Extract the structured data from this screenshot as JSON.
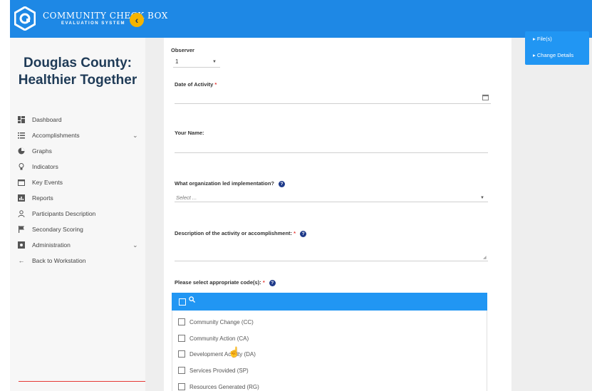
{
  "header": {
    "brand_line1": "COMMUNITY CHECK BOX",
    "brand_line2": "EVALUATION SYSTEM",
    "collapse_icon": "chevron-left-icon",
    "accent_color": "#1e88e5",
    "collapse_color": "#f5b400"
  },
  "sidebar": {
    "org_title_line1": "Douglas County:",
    "org_title_line2": "Healthier Together",
    "items": [
      {
        "label": "Dashboard",
        "icon": "dashboard-icon",
        "has_chevron": false
      },
      {
        "label": "Accomplishments",
        "icon": "list-icon",
        "has_chevron": true
      },
      {
        "label": "Graphs",
        "icon": "pie-chart-icon",
        "has_chevron": false
      },
      {
        "label": "Indicators",
        "icon": "lightbulb-icon",
        "has_chevron": false
      },
      {
        "label": "Key Events",
        "icon": "calendar-icon",
        "has_chevron": false
      },
      {
        "label": "Reports",
        "icon": "report-icon",
        "has_chevron": false
      },
      {
        "label": "Participants Description",
        "icon": "person-icon",
        "has_chevron": false
      },
      {
        "label": "Secondary Scoring",
        "icon": "flag-icon",
        "has_chevron": false
      },
      {
        "label": "Administration",
        "icon": "admin-icon",
        "has_chevron": true
      },
      {
        "label": "Back to Workstation",
        "icon": "arrow-left-icon",
        "has_chevron": false
      }
    ]
  },
  "popup": {
    "items": [
      {
        "label": "File(s)"
      },
      {
        "label": "Change Details"
      }
    ]
  },
  "form": {
    "observer_label": "Observer",
    "observer_value": "1",
    "date_label": "Date of Activity",
    "name_label": "Your Name:",
    "org_label": "What organization led implementation?",
    "org_placeholder": "Select ...",
    "description_label": "Description of the activity or accomplishment:",
    "codes_label": "Please select appropriate code(s):",
    "required_mark": "*",
    "help_glyph": "?",
    "codes": [
      {
        "label": "Community Change (CC)"
      },
      {
        "label": "Community Action (CA)"
      },
      {
        "label": "Development Activity (DA)"
      },
      {
        "label": "Services Provided (SP)"
      },
      {
        "label": "Resources Generated (RG)"
      }
    ]
  }
}
